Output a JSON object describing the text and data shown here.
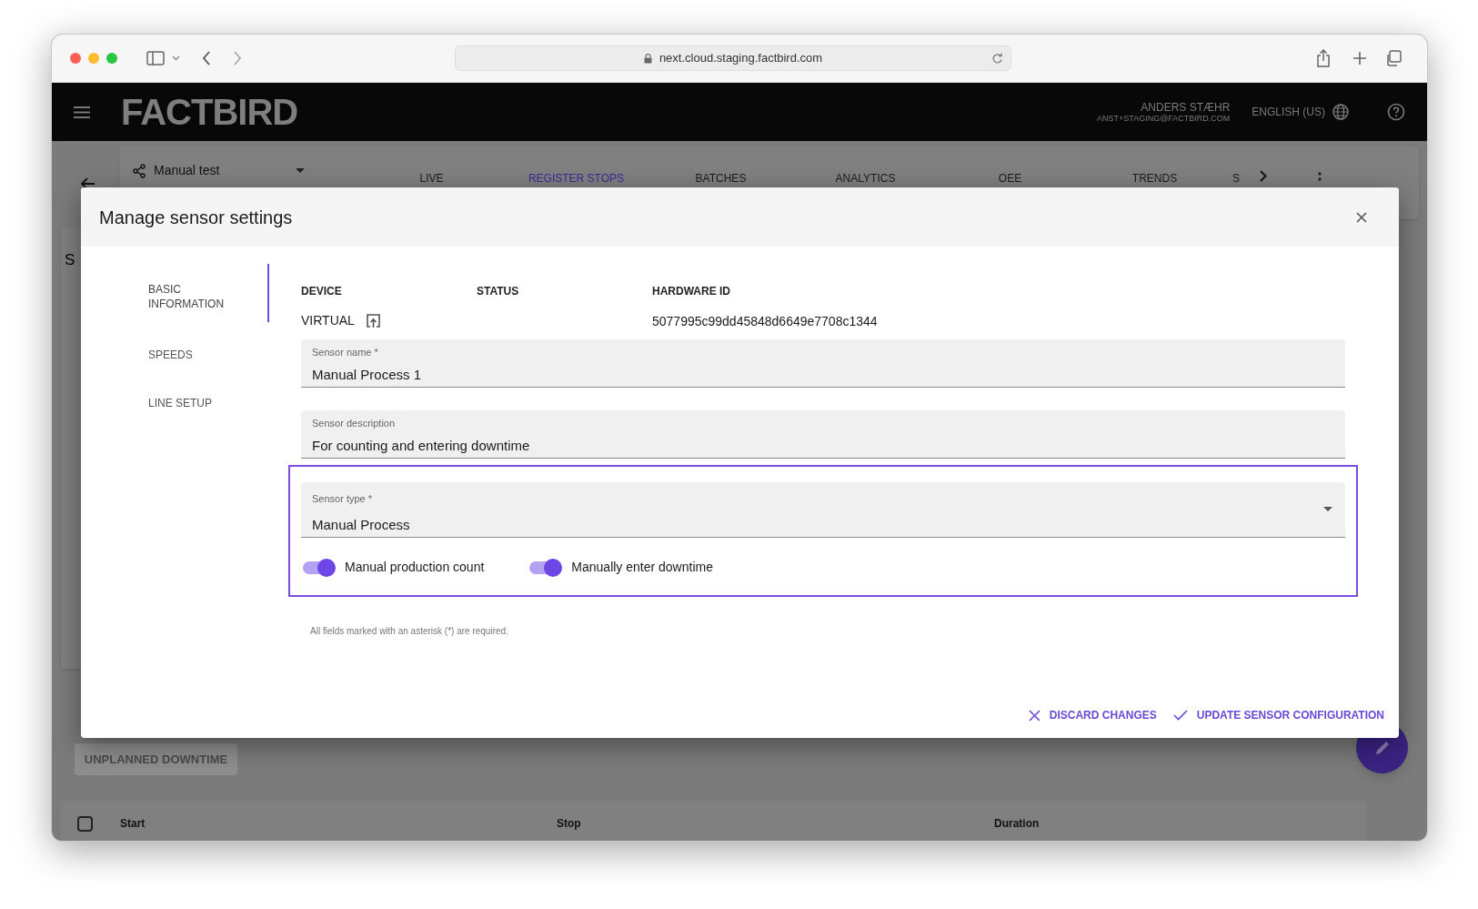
{
  "browser": {
    "url": "next.cloud.staging.factbird.com"
  },
  "app_header": {
    "logo": "FACTBIRD",
    "user_name": "ANDERS STÆHR",
    "user_email": "ANST+STAGING@FACTBIRD.COM",
    "language": "ENGLISH (US)"
  },
  "line_selector": {
    "value": "Manual test"
  },
  "tabs": [
    {
      "label": "LIVE",
      "selected": false
    },
    {
      "label": "REGISTER STOPS",
      "selected": true
    },
    {
      "label": "BATCHES",
      "selected": false
    },
    {
      "label": "ANALYTICS",
      "selected": false
    },
    {
      "label": "OEE",
      "selected": false
    },
    {
      "label": "TRENDS",
      "selected": false
    },
    {
      "label": "S",
      "selected": false
    }
  ],
  "background": {
    "section_letter": "S",
    "button": "UNPLANNED DOWNTIME",
    "select_all": {
      "checked": false
    },
    "table_columns": [
      "Start",
      "Stop",
      "Duration"
    ]
  },
  "dialog": {
    "title": "Manage sensor settings",
    "nav": [
      {
        "label": "BASIC INFORMATION",
        "selected": true
      },
      {
        "label": "SPEEDS",
        "selected": false
      },
      {
        "label": "LINE SETUP",
        "selected": false
      }
    ],
    "info_columns": [
      {
        "heading": "DEVICE",
        "value": "VIRTUAL",
        "kind": "device"
      },
      {
        "heading": "STATUS",
        "kind": "text"
      },
      {
        "heading": "HARDWARE ID",
        "value": "5077995c99dd45848d6649e7708c1344",
        "kind": "text"
      }
    ],
    "fields": [
      {
        "label": "Sensor name *",
        "value": "Manual Process 1"
      },
      {
        "label": "Sensor description",
        "value": "For counting and entering downtime"
      }
    ],
    "sensor_type": {
      "label": "Sensor type *",
      "value": "Manual Process"
    },
    "toggles": [
      {
        "label": "Manual production count",
        "on": true
      },
      {
        "label": "Manually enter downtime",
        "on": true
      }
    ],
    "footnote": "All fields marked with an asterisk (*) are required.",
    "actions": [
      {
        "label": "DISCARD CHANGES",
        "kind": "discard"
      },
      {
        "label": "UPDATE SENSOR CONFIGURATION",
        "kind": "confirm"
      }
    ]
  }
}
